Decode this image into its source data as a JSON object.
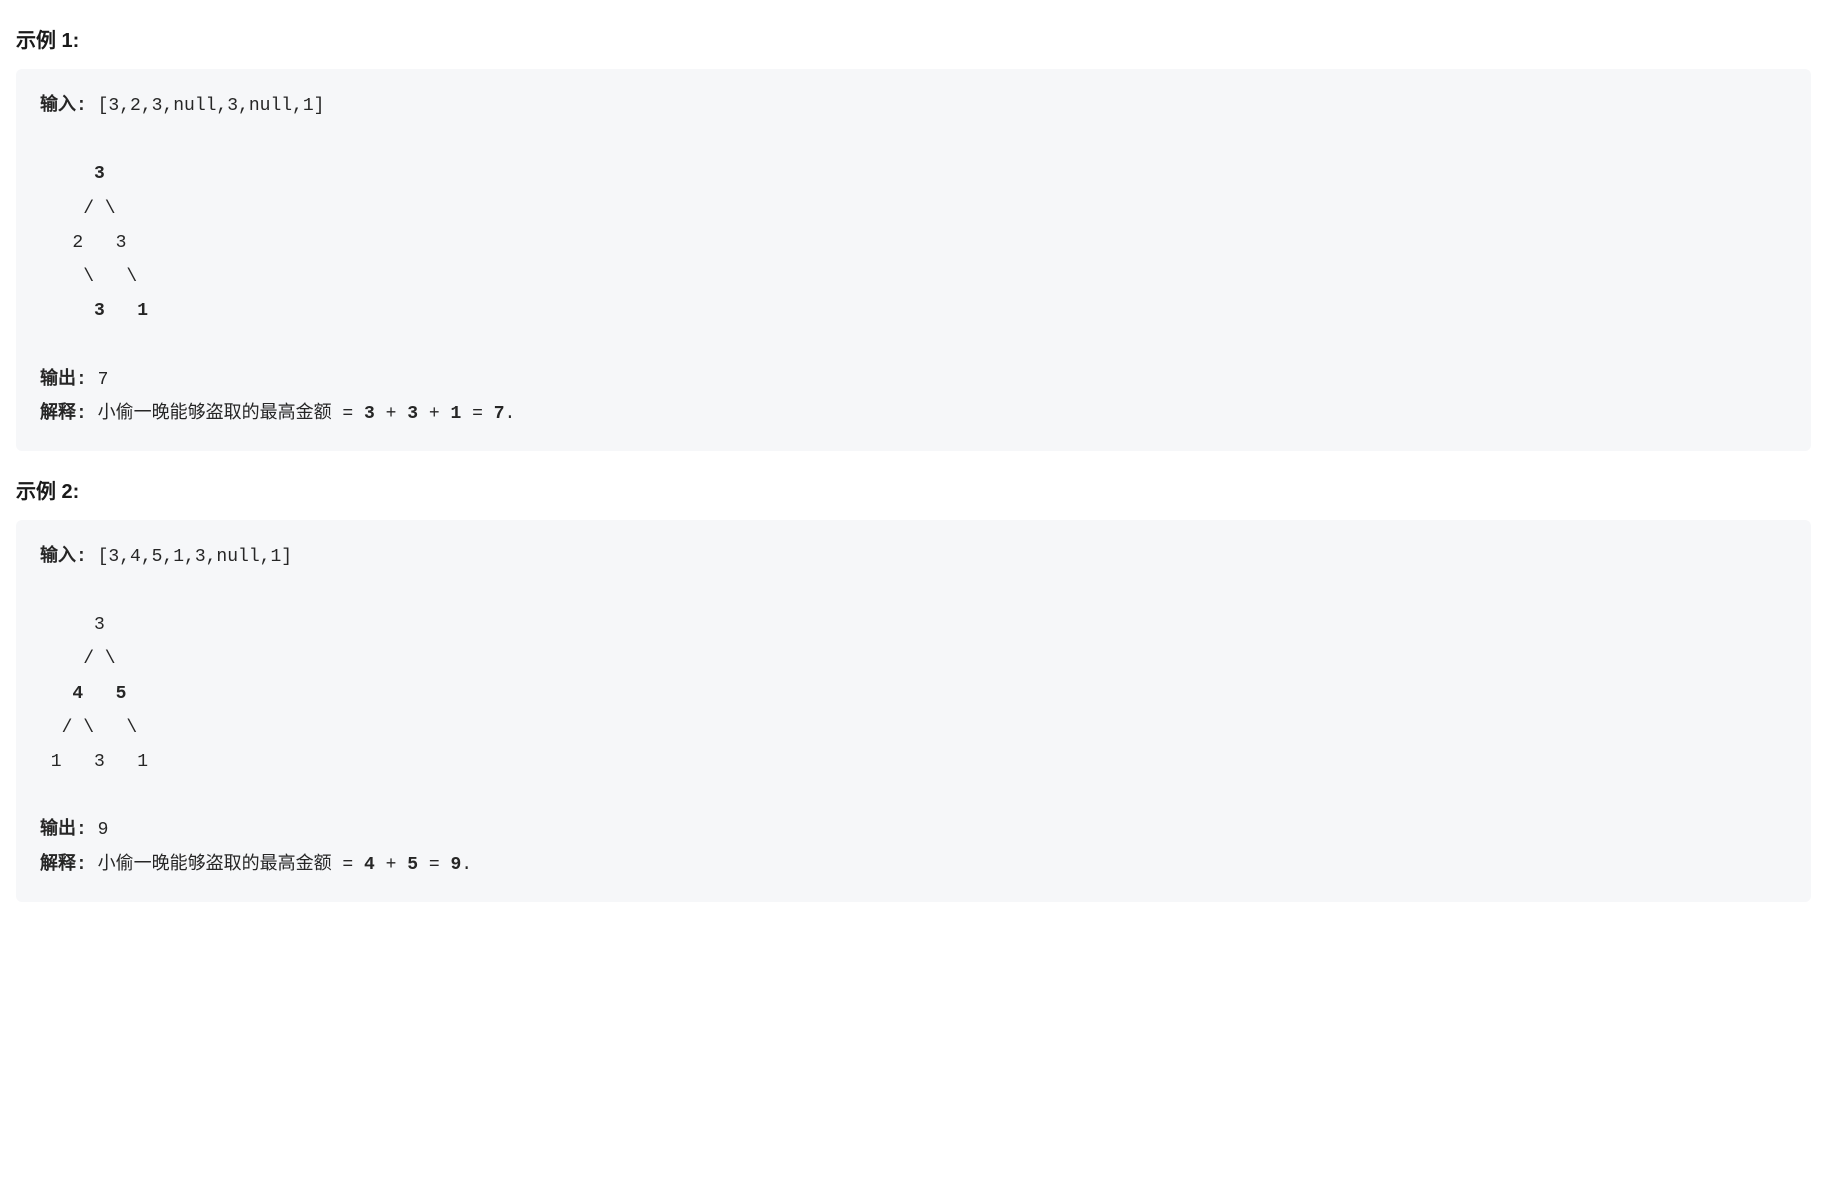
{
  "example1": {
    "heading": "示例 1:",
    "input_label": "输入: ",
    "input_value": "[3,2,3,null,3,null,1]",
    "tree_line1": "     3",
    "tree_line2": "    / \\",
    "tree_line3": "   2   3",
    "tree_line4": "    \\   \\",
    "tree_line5_prefix": "     ",
    "tree_line5_val1": "3",
    "tree_line5_mid": "   ",
    "tree_line5_val2": "1",
    "output_label": "输出:",
    "output_value": " 7",
    "explain_label": "解释:",
    "explain_text": " 小偷一晚能够盗取的最高金额 = ",
    "explain_calc": "3",
    "explain_plus1": " + ",
    "explain_val2": "3",
    "explain_plus2": " + ",
    "explain_val3": "1",
    "explain_eq": " = ",
    "explain_result": "7",
    "explain_period": "."
  },
  "example2": {
    "heading": "示例 2:",
    "input_label": "输入: ",
    "input_value": "[3,4,5,1,3,null,1]",
    "tree_line1": "     3",
    "tree_line2": "    / \\",
    "tree_line3_prefix": "   ",
    "tree_line3_val1": "4",
    "tree_line3_mid": "   ",
    "tree_line3_val2": "5",
    "tree_line4": "  / \\   \\",
    "tree_line5": " 1   3   1",
    "output_label": "输出:",
    "output_value": " 9",
    "explain_label": "解释:",
    "explain_text": " 小偷一晚能够盗取的最高金额 = ",
    "explain_val1": "4",
    "explain_plus1": " + ",
    "explain_val2": "5",
    "explain_eq": " = ",
    "explain_result": "9",
    "explain_period": "."
  }
}
